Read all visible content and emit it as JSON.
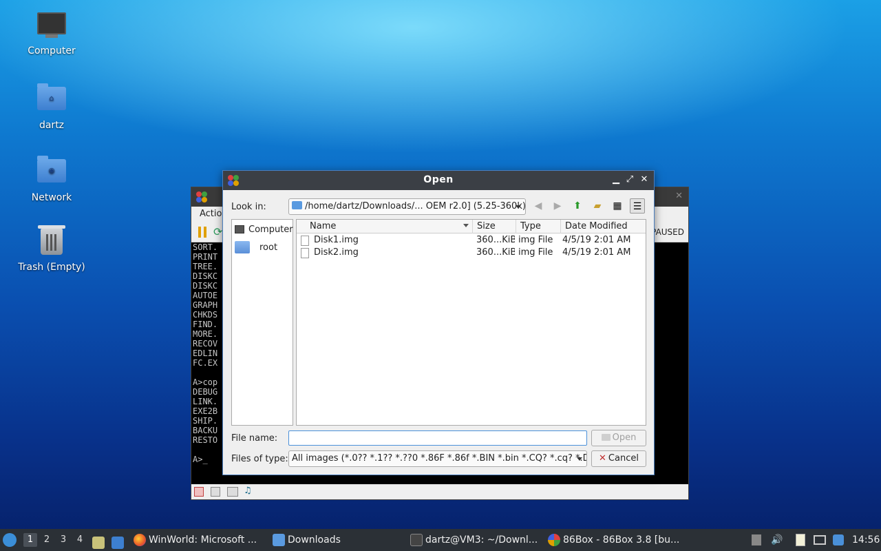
{
  "desktop": {
    "icons": [
      {
        "label": "Computer"
      },
      {
        "label": "dartz"
      },
      {
        "label": "Network"
      },
      {
        "label": "Trash (Empty)"
      }
    ]
  },
  "bg_window": {
    "menu_action": "Actio",
    "status_text": "PAUSED",
    "dos_lines": "SORT.\nPRINT\nTREE.\nDISKC\nDISKC\nAUTOE\nGRAPH\nCHKDS\nFIND.\nMORE.\nRECOV\nEDLIN\nFC.EX\n\nA>cop\nDEBUG\nLINK.\nEXE2B\nSHIP.\nBACKU\nRESTO\n\nA>_"
  },
  "dialog": {
    "title": "Open",
    "look_in_label": "Look in:",
    "look_in_value": "/home/dartz/Downloads/... OEM r2.0] (5.25-360k)",
    "sidebar": [
      {
        "label": "Computer"
      },
      {
        "label": "root"
      }
    ],
    "columns": {
      "name": "Name",
      "size": "Size",
      "type": "Type",
      "date": "Date Modified"
    },
    "files": [
      {
        "name": "Disk1.img",
        "size": "360...KiB",
        "type": "img File",
        "date": "4/5/19 2:01 AM"
      },
      {
        "name": "Disk2.img",
        "size": "360...KiB",
        "type": "img File",
        "date": "4/5/19 2:01 AM"
      }
    ],
    "file_name_label": "File name:",
    "file_name_value": "",
    "files_of_type_label": "Files of type:",
    "files_of_type_value": "All images (*.0?? *.1?? *.??0 *.86F *.86f *.BIN *.bin *.CQ? *.cq? *.D?",
    "open_label": "Open",
    "cancel_label": "Cancel"
  },
  "taskbar": {
    "workspaces": [
      "1",
      "2",
      "3",
      "4"
    ],
    "tasks": [
      {
        "label": "WinWorld: Microsoft ..."
      },
      {
        "label": "Downloads"
      },
      {
        "label": "dartz@VM3: ~/Downl..."
      },
      {
        "label": "86Box - 86Box 3.8 [bu..."
      }
    ],
    "clock": "14:56"
  }
}
